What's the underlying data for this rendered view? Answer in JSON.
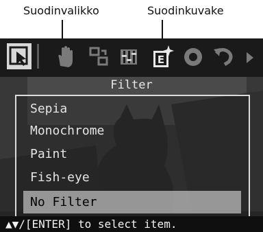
{
  "callouts": {
    "menu": "Suodinvalikko",
    "icon": "Suodinkuvake"
  },
  "menu": {
    "title": "Filter",
    "items": [
      "Sepia",
      "Monochrome",
      "Paint",
      "Fish-eye",
      "No Filter"
    ],
    "selected_index": 4
  },
  "hint": "▲▼/[ENTER] to select item.",
  "toolbar": {
    "icons": [
      "select-icon",
      "hand-icon",
      "move-icon",
      "adjust-icon",
      "filter-icon",
      "red-eye-icon",
      "undo-icon",
      "arrow-right-icon"
    ]
  },
  "colors": {
    "screen_bg": "#262626",
    "highlight": "#aaaaaa",
    "text": "#e4e4e4"
  }
}
